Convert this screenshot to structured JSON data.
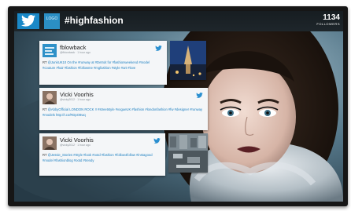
{
  "header": {
    "brand_logo_text": "LOGO",
    "hashtag": "#highfashion",
    "follower_count": "1134",
    "follower_label": "FOLLOWERS"
  },
  "tweets": [
    {
      "name": "fblowback",
      "handle": "@fblowback · 1 hour ago",
      "lead": "RT ",
      "body": "@JunkUK10 On the #runway at #Detroit for #fashionweekend #model #couture #hair #fashion #followme #mgfashion #style #art #love"
    },
    {
      "name": "Vicki Voorhis",
      "handle": "@vicky2012 · 1 hour ago",
      "lead": "RT ",
      "body": "@AbbyOfficial LONDON ROCK !! #streetstyle #vogueUK #fashion #londonfashion #fw #designer #runway #models http://t.co/RDpO8wq"
    },
    {
      "name": "Vicki Voorhis",
      "handle": "@vicky2012 · 1 hour ago",
      "lead": "RT ",
      "body": "@Jessie_Stories #Style #look #ootd #fashion #follow4follow #instagood #model #fashionblog #ootd #trendy"
    }
  ],
  "colors": {
    "twitter_blue": "#1a88c7",
    "topbar": "#1a2126",
    "card": "#f4f6f8",
    "link": "#1c7fc0"
  },
  "icons": {
    "header_bird": "twitter-bird-icon",
    "card_bird": "twitter-bird-icon"
  }
}
